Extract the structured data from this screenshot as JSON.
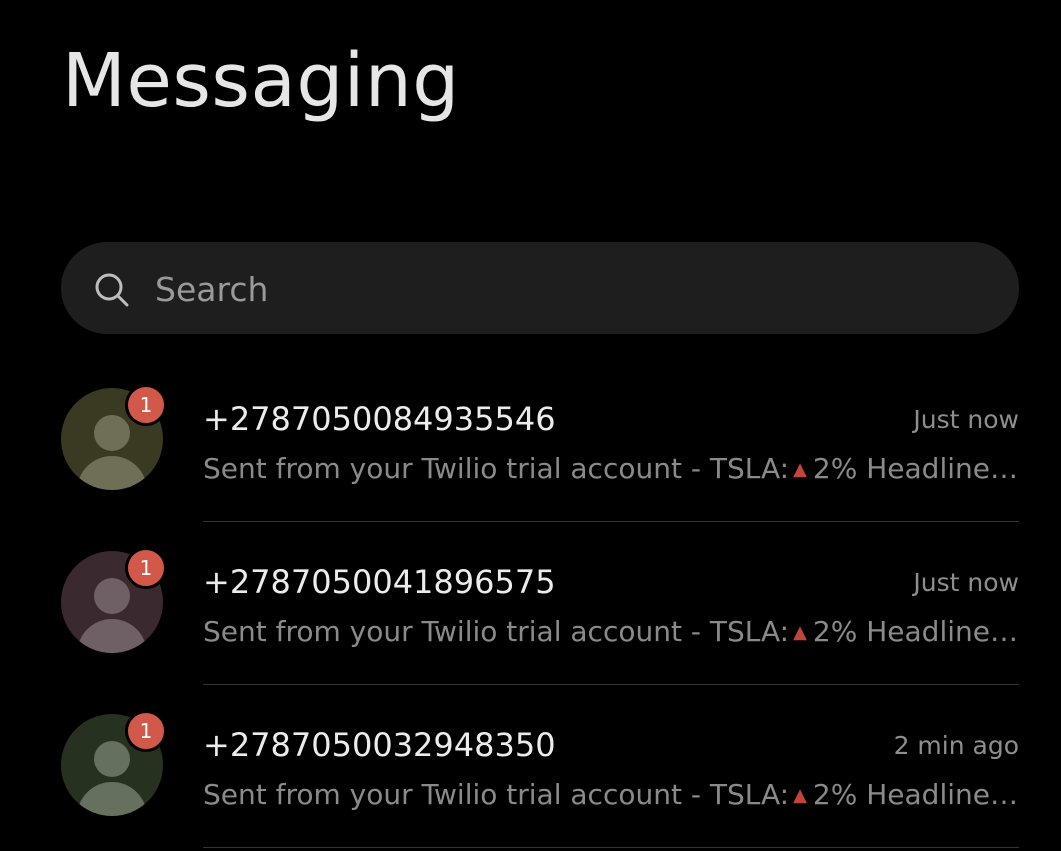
{
  "header": {
    "title": "Messaging"
  },
  "search": {
    "placeholder": "Search",
    "icon": "search-icon"
  },
  "conversations": [
    {
      "number": "+2787050084935546",
      "time": "Just now",
      "preview_prefix": "Sent from your Twilio trial account - TSLA:",
      "trend_icon": "triangle-up-icon",
      "preview_suffix": "2%  Headline:...",
      "unread": "1",
      "avatar_color": "#3a3a22",
      "avatar_figure_color": "#6f6f58"
    },
    {
      "number": "+2787050041896575",
      "time": "Just now",
      "preview_prefix": "Sent from your Twilio trial account - TSLA:",
      "trend_icon": "triangle-up-icon",
      "preview_suffix": "2%  Headline:...",
      "unread": "1",
      "avatar_color": "#3a2a30",
      "avatar_figure_color": "#6e6065"
    },
    {
      "number": "+2787050032948350",
      "time": "2 min ago",
      "preview_prefix": "Sent from your Twilio trial account - TSLA:",
      "trend_icon": "triangle-up-icon",
      "preview_suffix": "2%  Headline:...",
      "unread": "1",
      "avatar_color": "#26321f",
      "avatar_figure_color": "#66705e"
    }
  ],
  "colors": {
    "badge": "#d2594a",
    "trend_up": "#c0453a",
    "background": "#000000"
  }
}
